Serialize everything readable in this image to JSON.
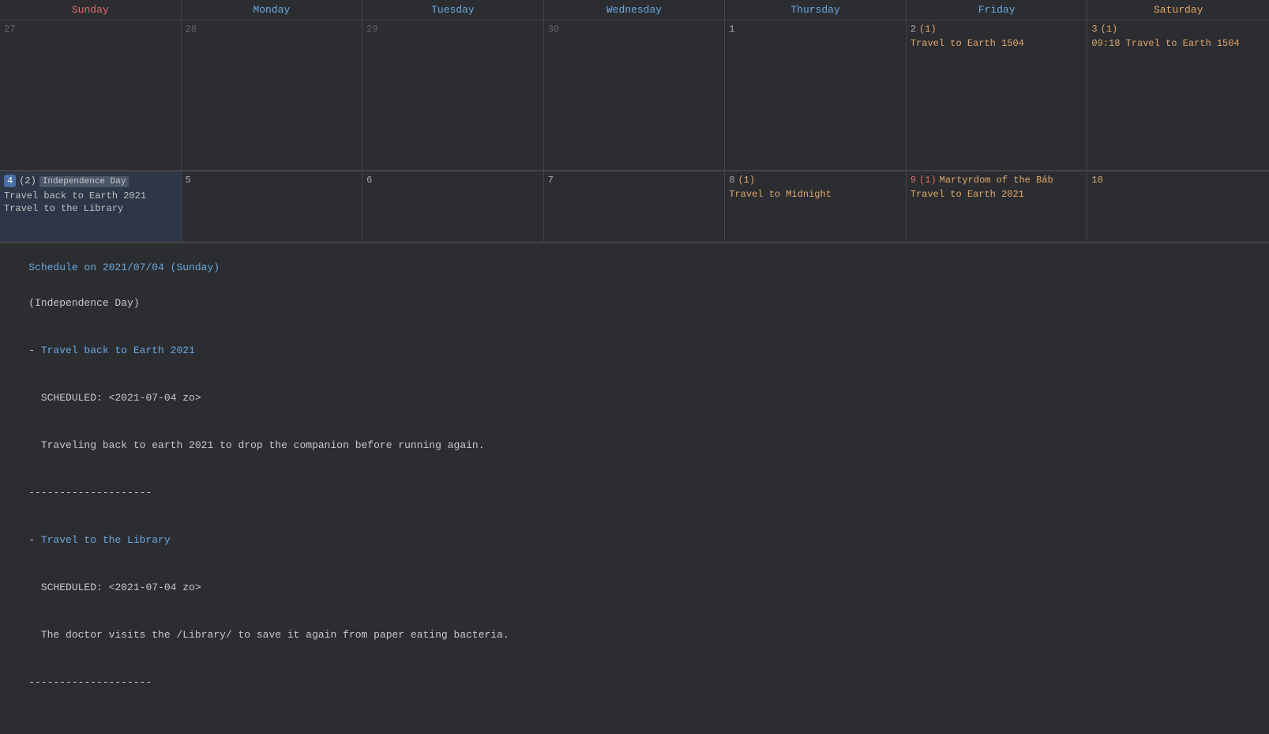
{
  "calendar": {
    "headers": [
      {
        "label": "Sunday",
        "class": "sunday"
      },
      {
        "label": "Monday",
        "class": "monday"
      },
      {
        "label": "Tuesday",
        "class": "tuesday"
      },
      {
        "label": "Wednesday",
        "class": "wednesday"
      },
      {
        "label": "Thursday",
        "class": "thursday"
      },
      {
        "label": "Friday",
        "class": "friday"
      },
      {
        "label": "Saturday",
        "class": "saturday"
      }
    ],
    "rows": [
      {
        "cells": [
          {
            "day": "27",
            "type": "gray",
            "events": []
          },
          {
            "day": "28",
            "type": "gray",
            "events": []
          },
          {
            "day": "29",
            "type": "gray",
            "events": []
          },
          {
            "day": "30",
            "type": "gray",
            "events": []
          },
          {
            "day": "1",
            "type": "normal",
            "events": []
          },
          {
            "day": "2",
            "type": "normal",
            "count": "(1)",
            "count_color": "orange",
            "events": [
              {
                "text": "Travel to Earth 1504",
                "color": "orange"
              }
            ]
          },
          {
            "day": "3",
            "type": "saturday",
            "count": "(1)",
            "count_color": "orange",
            "events": [
              {
                "text": "09:18 Travel to Earth 1504",
                "color": "orange"
              }
            ]
          }
        ]
      },
      {
        "cells": [
          {
            "day": "4",
            "type": "today",
            "holiday": "Independence Day",
            "count": "(2)",
            "count_color": "white",
            "events": [
              {
                "text": "Travel back to Earth 2021",
                "color": "plain"
              },
              {
                "text": "Travel to the Library",
                "color": "plain"
              }
            ]
          },
          {
            "day": "5",
            "type": "normal",
            "events": []
          },
          {
            "day": "6",
            "type": "normal",
            "events": []
          },
          {
            "day": "7",
            "type": "normal",
            "events": []
          },
          {
            "day": "8",
            "type": "normal",
            "count": "(1)",
            "count_color": "orange",
            "events": [
              {
                "text": "Travel to Midnight",
                "color": "orange"
              }
            ]
          },
          {
            "day": "9",
            "type": "normal",
            "count": "(1)",
            "count_color": "red",
            "holiday": "Martyrdom of the Báb",
            "events": [
              {
                "text": "Travel to Earth 2021",
                "color": "orange"
              }
            ]
          },
          {
            "day": "10",
            "type": "saturday",
            "events": []
          }
        ]
      }
    ]
  },
  "schedule": {
    "title": "Schedule on 2021/07/04 (Sunday)",
    "holiday": "(Independence Day)",
    "events": [
      {
        "title": "Travel back to Earth 2021",
        "scheduled": "SCHEDULED: <2021-07-04 zo>",
        "description": "Traveling back to earth 2021 to drop the companion before running again."
      },
      {
        "title": "Travel to the Library",
        "scheduled": "SCHEDULED: <2021-07-04 zo>",
        "description": "The doctor visits the /Library/ to save it again from paper eating bacteria."
      }
    ],
    "separator": "--------------------"
  }
}
